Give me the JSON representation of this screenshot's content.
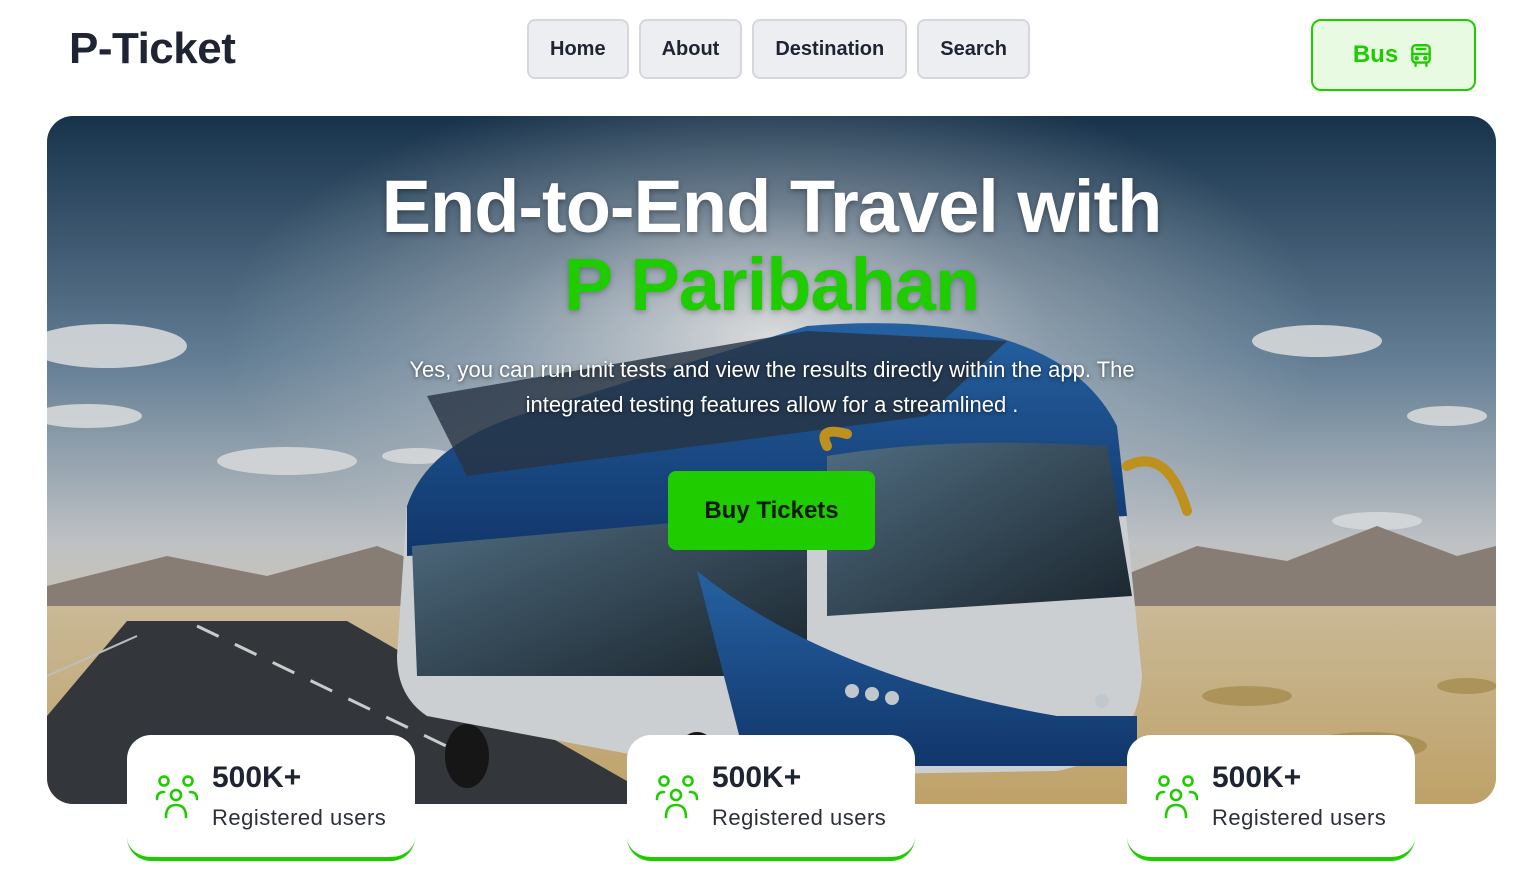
{
  "header": {
    "logo": "P-Ticket",
    "nav": [
      "Home",
      "About",
      "Destination",
      "Search"
    ],
    "bus_button": {
      "label": "Bus",
      "icon": "bus-icon"
    }
  },
  "hero": {
    "title_line1": "End-to-End Travel with",
    "title_line2": "P Paribahan",
    "description": "Yes, you can run unit tests and view the results directly within the app. The integrated testing features allow for a streamlined .",
    "cta_label": "Buy Tickets"
  },
  "stats": [
    {
      "value": "500K+",
      "label": "Registered users",
      "icon": "users-icon"
    },
    {
      "value": "500K+",
      "label": "Registered users",
      "icon": "users-icon"
    },
    {
      "value": "500K+",
      "label": "Registered users",
      "icon": "users-icon"
    }
  ],
  "colors": {
    "accent": "#1fcc00",
    "nav_bg": "#eceef2",
    "text_dark": "#1f2433"
  }
}
